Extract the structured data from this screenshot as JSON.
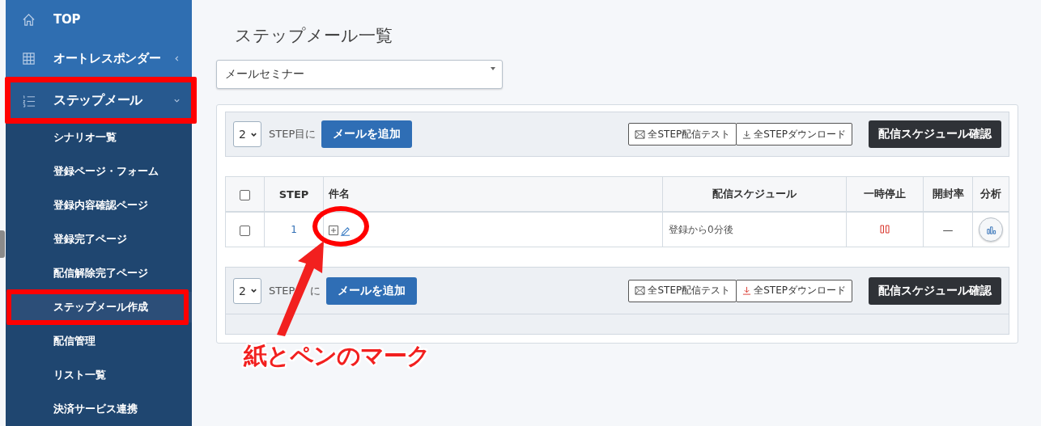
{
  "sidebar": {
    "items": [
      {
        "label": "TOP",
        "selected": false,
        "highlighted": false
      },
      {
        "label": "オートレスポンダー",
        "selected": false,
        "highlighted": false,
        "expanded": false
      },
      {
        "label": "ステップメール",
        "selected": true,
        "highlighted": true,
        "expanded": true,
        "children": [
          {
            "label": "シナリオ一覧",
            "selected": false,
            "highlighted": false
          },
          {
            "label": "登録ページ・フォーム",
            "selected": false,
            "highlighted": false
          },
          {
            "label": "登録内容確認ページ",
            "selected": false,
            "highlighted": false
          },
          {
            "label": "登録完了ページ",
            "selected": false,
            "highlighted": false
          },
          {
            "label": "配信解除完了ページ",
            "selected": false,
            "highlighted": false
          },
          {
            "label": "ステップメール作成",
            "selected": true,
            "highlighted": true
          },
          {
            "label": "配信管理",
            "selected": false,
            "highlighted": false
          },
          {
            "label": "リスト一覧",
            "selected": false,
            "highlighted": false
          },
          {
            "label": "決済サービス連携",
            "selected": false,
            "highlighted": false
          }
        ]
      }
    ]
  },
  "page_title": "ステップメール一覧",
  "scenario_select": {
    "value": "メールセミナー"
  },
  "toolbars": [
    {
      "step_select": "2",
      "step_label": "STEP目に",
      "add_button": "メールを追加",
      "test_button": "全STEP配信テスト",
      "download_button": "全STEPダウンロード",
      "schedule_button": "配信スケジュール確認"
    },
    {
      "step_select": "2",
      "step_label": "STEP",
      "step_label_tail": "に",
      "add_button": "メールを追加",
      "test_button": "全STEP配信テスト",
      "download_button": "全STEPダウンロード",
      "schedule_button": "配信スケジュール確認"
    }
  ],
  "table": {
    "all_checked": false,
    "columns": [
      "STEP",
      "件名",
      "配信スケジュール",
      "一時停止",
      "開封率",
      "分析"
    ],
    "rows": [
      {
        "checked": false,
        "step": "1",
        "schedule": "登録から0分後",
        "open_rate": "—"
      }
    ]
  },
  "annotation": {
    "callout": "紙とペンのマーク"
  }
}
